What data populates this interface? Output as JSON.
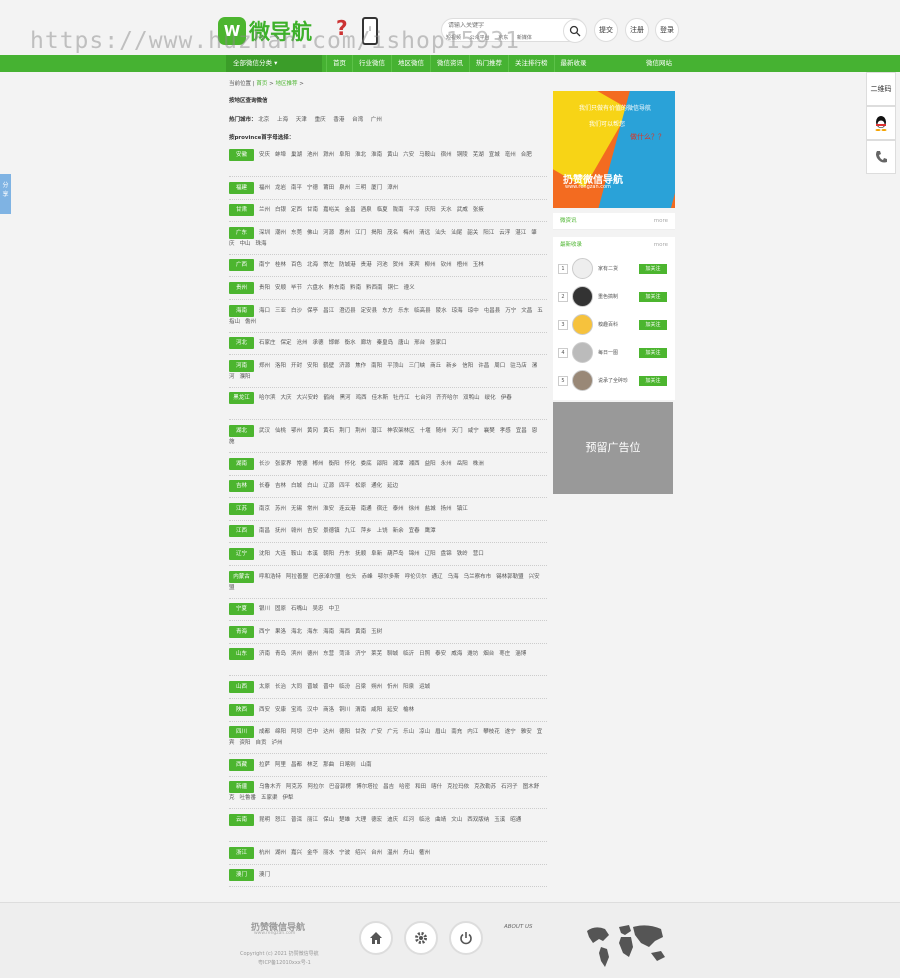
{
  "watermark": "https://www.huzhan.com/ishop15931",
  "header": {
    "logo_text": "微导航",
    "search_placeholder": "请输入关键字",
    "hot_words": [
      "短视频",
      "公众平台",
      "京东",
      "新媒体"
    ],
    "btn_submit": "提交",
    "btn_register": "注册",
    "btn_login": "登录"
  },
  "nav": {
    "all_label": "全部微信分类 ▾",
    "items": [
      "首页",
      "行业微信",
      "地区微信",
      "微信资讯",
      "热门推荐",
      "关注排行榜",
      "最新收录"
    ],
    "right": "微信网站"
  },
  "breadcrumb": {
    "prefix": "当前位置 |",
    "home": "首页",
    "sep": ">",
    "current": "地区推荐",
    "end": ">"
  },
  "region_title": "按地区查询微信",
  "hot_cities": {
    "label": "热门城市：",
    "items": [
      "北京",
      "上海",
      "天津",
      "重庆",
      "香港",
      "台湾",
      "广州"
    ]
  },
  "province_title": "按province首字母选择：",
  "provinces": [
    {
      "name": "安徽",
      "cities": [
        "安庆",
        "蚌埠",
        "巢湖",
        "池州",
        "滁州",
        "阜阳",
        "淮北",
        "淮南",
        "黄山",
        "六安",
        "马鞍山",
        "宿州",
        "铜陵",
        "芜湖",
        "宣城",
        "亳州",
        "合肥"
      ]
    },
    {
      "name": "福建",
      "cities": [
        "福州",
        "龙岩",
        "南平",
        "宁德",
        "莆田",
        "泉州",
        "三明",
        "厦门",
        "漳州"
      ]
    },
    {
      "name": "甘肃",
      "cities": [
        "兰州",
        "白银",
        "定西",
        "甘南",
        "嘉峪关",
        "金昌",
        "酒泉",
        "临夏",
        "陇南",
        "平凉",
        "庆阳",
        "天水",
        "武威",
        "张掖"
      ]
    },
    {
      "name": "广东",
      "cities": [
        "深圳",
        "潮州",
        "东莞",
        "佛山",
        "河源",
        "惠州",
        "江门",
        "揭阳",
        "茂名",
        "梅州",
        "清远",
        "汕头",
        "汕尾",
        "韶关",
        "阳江",
        "云浮",
        "湛江",
        "肇庆",
        "中山",
        "珠海"
      ]
    },
    {
      "name": "广西",
      "cities": [
        "南宁",
        "桂林",
        "百色",
        "北海",
        "崇左",
        "防城港",
        "贵港",
        "河池",
        "贺州",
        "来宾",
        "柳州",
        "钦州",
        "梧州",
        "玉林"
      ]
    },
    {
      "name": "贵州",
      "cities": [
        "贵阳",
        "安顺",
        "毕节",
        "六盘水",
        "黔东南",
        "黔南",
        "黔西南",
        "铜仁",
        "遵义"
      ]
    },
    {
      "name": "海南",
      "cities": [
        "海口",
        "三亚",
        "白沙",
        "保亭",
        "昌江",
        "澄迈县",
        "定安县",
        "东方",
        "乐东",
        "临高县",
        "陵水",
        "琼海",
        "琼中",
        "屯昌县",
        "万宁",
        "文昌",
        "五指山",
        "儋州"
      ]
    },
    {
      "name": "河北",
      "cities": [
        "石家庄",
        "保定",
        "沧州",
        "承德",
        "邯郸",
        "衡水",
        "廊坊",
        "秦皇岛",
        "唐山",
        "邢台",
        "张家口"
      ]
    },
    {
      "name": "河南",
      "cities": [
        "郑州",
        "洛阳",
        "开封",
        "安阳",
        "鹤壁",
        "济源",
        "焦作",
        "南阳",
        "平顶山",
        "三门峡",
        "商丘",
        "新乡",
        "信阳",
        "许昌",
        "周口",
        "驻马店",
        "漯河",
        "濮阳"
      ]
    },
    {
      "name": "黑龙江",
      "cities": [
        "哈尔滨",
        "大庆",
        "大兴安岭",
        "鹤岗",
        "黑河",
        "鸡西",
        "佳木斯",
        "牡丹江",
        "七台河",
        "齐齐哈尔",
        "双鸭山",
        "绥化",
        "伊春"
      ]
    },
    {
      "name": "湖北",
      "cities": [
        "武汉",
        "仙桃",
        "鄂州",
        "黄冈",
        "黄石",
        "荆门",
        "荆州",
        "潜江",
        "神农架林区",
        "十堰",
        "随州",
        "天门",
        "咸宁",
        "襄樊",
        "孝感",
        "宜昌",
        "恩施"
      ]
    },
    {
      "name": "湖南",
      "cities": [
        "长沙",
        "张家界",
        "常德",
        "郴州",
        "衡阳",
        "怀化",
        "娄底",
        "邵阳",
        "湘潭",
        "湘西",
        "益阳",
        "永州",
        "岳阳",
        "株洲"
      ]
    },
    {
      "name": "吉林",
      "cities": [
        "长春",
        "吉林",
        "白城",
        "白山",
        "辽源",
        "四平",
        "松原",
        "通化",
        "延边"
      ]
    },
    {
      "name": "江苏",
      "cities": [
        "南京",
        "苏州",
        "无锡",
        "常州",
        "淮安",
        "连云港",
        "南通",
        "宿迁",
        "泰州",
        "徐州",
        "盐城",
        "扬州",
        "镇江"
      ]
    },
    {
      "name": "江西",
      "cities": [
        "南昌",
        "抚州",
        "赣州",
        "吉安",
        "景德镇",
        "九江",
        "萍乡",
        "上饶",
        "新余",
        "宜春",
        "鹰潭"
      ]
    },
    {
      "name": "辽宁",
      "cities": [
        "沈阳",
        "大连",
        "鞍山",
        "本溪",
        "朝阳",
        "丹东",
        "抚顺",
        "阜新",
        "葫芦岛",
        "锦州",
        "辽阳",
        "盘锦",
        "铁岭",
        "营口"
      ]
    },
    {
      "name": "内蒙古",
      "cities": [
        "呼和浩特",
        "阿拉善盟",
        "巴彦淖尔盟",
        "包头",
        "赤峰",
        "鄂尔多斯",
        "呼伦贝尔",
        "通辽",
        "乌海",
        "乌兰察布市",
        "锡林郭勒盟",
        "兴安盟"
      ]
    },
    {
      "name": "宁夏",
      "cities": [
        "银川",
        "固原",
        "石嘴山",
        "吴忠",
        "中卫"
      ]
    },
    {
      "name": "青海",
      "cities": [
        "西宁",
        "果洛",
        "海北",
        "海东",
        "海南",
        "海西",
        "黄南",
        "玉树"
      ]
    },
    {
      "name": "山东",
      "cities": [
        "济南",
        "青岛",
        "滨州",
        "德州",
        "东营",
        "菏泽",
        "济宁",
        "莱芜",
        "聊城",
        "临沂",
        "日照",
        "泰安",
        "威海",
        "潍坊",
        "烟台",
        "枣庄",
        "淄博"
      ]
    },
    {
      "name": "山西",
      "cities": [
        "太原",
        "长治",
        "大同",
        "晋城",
        "晋中",
        "临汾",
        "吕梁",
        "朔州",
        "忻州",
        "阳泉",
        "运城"
      ]
    },
    {
      "name": "陕西",
      "cities": [
        "西安",
        "安康",
        "宝鸡",
        "汉中",
        "商洛",
        "铜川",
        "渭南",
        "咸阳",
        "延安",
        "榆林"
      ]
    },
    {
      "name": "四川",
      "cities": [
        "成都",
        "绵阳",
        "阿坝",
        "巴中",
        "达州",
        "德阳",
        "甘孜",
        "广安",
        "广元",
        "乐山",
        "凉山",
        "眉山",
        "南充",
        "内江",
        "攀枝花",
        "遂宁",
        "雅安",
        "宜宾",
        "资阳",
        "自贡",
        "泸州"
      ]
    },
    {
      "name": "西藏",
      "cities": [
        "拉萨",
        "阿里",
        "昌都",
        "林芝",
        "那曲",
        "日喀则",
        "山南"
      ]
    },
    {
      "name": "新疆",
      "cities": [
        "乌鲁木齐",
        "阿克苏",
        "阿拉尔",
        "巴音郭楞",
        "博尔塔拉",
        "昌吉",
        "哈密",
        "和田",
        "喀什",
        "克拉玛依",
        "克孜勒苏",
        "石河子",
        "图木舒克",
        "吐鲁番",
        "五家渠",
        "伊犁"
      ]
    },
    {
      "name": "云南",
      "cities": [
        "昆明",
        "怒江",
        "普洱",
        "丽江",
        "保山",
        "楚雄",
        "大理",
        "德宏",
        "迪庆",
        "红河",
        "临沧",
        "曲靖",
        "文山",
        "西双版纳",
        "玉溪",
        "昭通"
      ]
    },
    {
      "name": "浙江",
      "cities": [
        "杭州",
        "湖州",
        "嘉兴",
        "金华",
        "丽水",
        "宁波",
        "绍兴",
        "台州",
        "温州",
        "舟山",
        "衢州"
      ]
    },
    {
      "name": "澳门",
      "cities": [
        "澳门"
      ]
    }
  ],
  "sidebar": {
    "ad1": {
      "line1": "我们只做有价值的微信导航",
      "line2": "我们可以帮您",
      "line3": "做什么？？",
      "brand": "扔赞微信导航",
      "url": "www.rengzan.com"
    },
    "news_title": "微资讯",
    "news_more": "more",
    "latest_title": "最新收录",
    "latest_more": "more",
    "latest": [
      {
        "rank": "1",
        "name": "家有二货",
        "btn": "加关注"
      },
      {
        "rank": "2",
        "name": "重色搞制",
        "btn": "加关注"
      },
      {
        "rank": "3",
        "name": "糗趣百科",
        "btn": "加关注"
      },
      {
        "rank": "4",
        "name": "每日一图",
        "btn": "加关注"
      },
      {
        "rank": "5",
        "name": "说承了全碎珍",
        "btn": "加关注"
      }
    ],
    "ad2": "预留广告位"
  },
  "right_tabs": {
    "qr": "二维码"
  },
  "share_tab": "分享",
  "footer": {
    "brand": "扔赞微信导航",
    "url": "www.rengzan.com",
    "copyright": "Copyright (c) 2021 扔赞微信导航",
    "icp": "粤ICP备12010xxx号-1",
    "about": "ABOUT US"
  },
  "colors": {
    "green": "#4cb52f",
    "dark_green": "#3b9d29",
    "ad_gray": "#999999"
  }
}
